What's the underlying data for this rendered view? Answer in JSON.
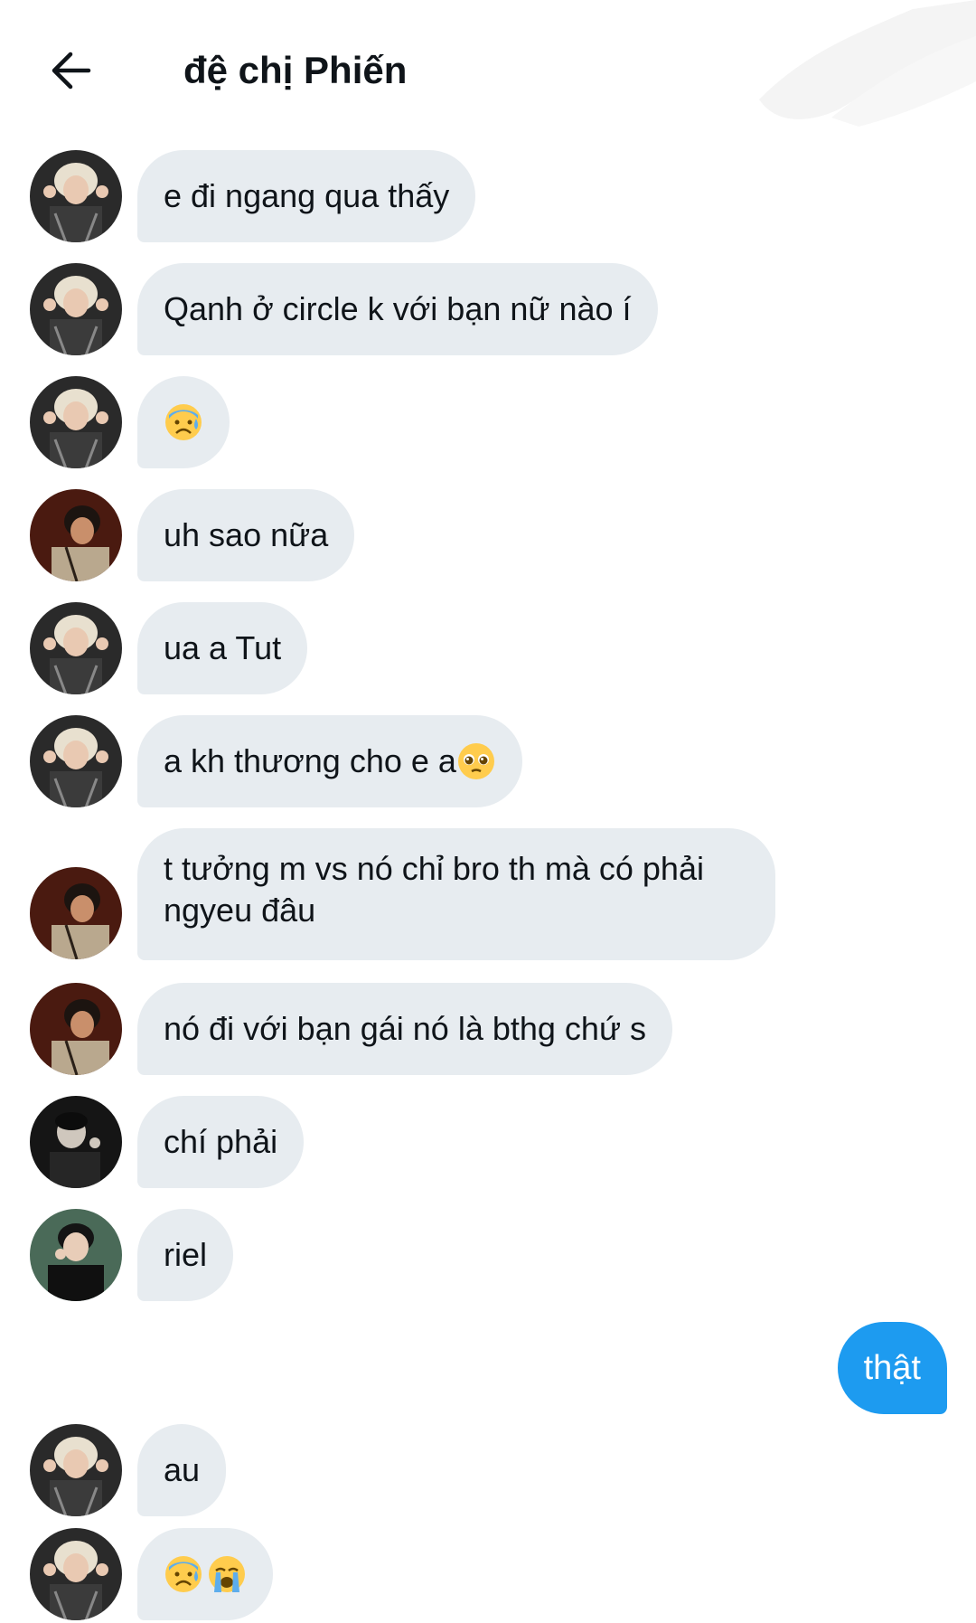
{
  "header": {
    "title": "đệ chị Phiến"
  },
  "messages": [
    {
      "text": "e đi ngang qua thấy",
      "avatar": "avatar-blond-1"
    },
    {
      "text": "Qanh ở circle k với bạn nữ nào í",
      "avatar": "avatar-blond-1"
    },
    {
      "text": "",
      "emojis": [
        "anxious-sweat-emoji"
      ],
      "avatar": "avatar-blond-1"
    },
    {
      "text": "uh sao nữa",
      "avatar": "avatar-dark-red"
    },
    {
      "text": "ua a Tut",
      "avatar": "avatar-blond-1"
    },
    {
      "text": "a kh thương cho e a",
      "emojis": [
        "pleading-face-emoji"
      ],
      "avatar": "avatar-blond-1"
    },
    {
      "text": "t tưởng m vs nó chỉ bro th mà có phải ngyeu đâu",
      "avatar": "avatar-dark-red"
    },
    {
      "text": "nó đi với bạn gái nó là bthg chứ s",
      "avatar": "avatar-dark-red"
    },
    {
      "text": "chí phải",
      "avatar": "avatar-dark-mono"
    },
    {
      "text": "riel",
      "avatar": "avatar-dark-hair"
    },
    {
      "text": "thật",
      "mine": true
    },
    {
      "text": "au",
      "avatar": "avatar-blond-1"
    },
    {
      "text": "",
      "emojis": [
        "anxious-sweat-emoji",
        "loudly-crying-emoji"
      ],
      "avatar": "avatar-blond-1"
    }
  ],
  "colors": {
    "bubble_other": "#e7ecf0",
    "bubble_mine": "#1d9bf0",
    "text": "#0f1419"
  }
}
